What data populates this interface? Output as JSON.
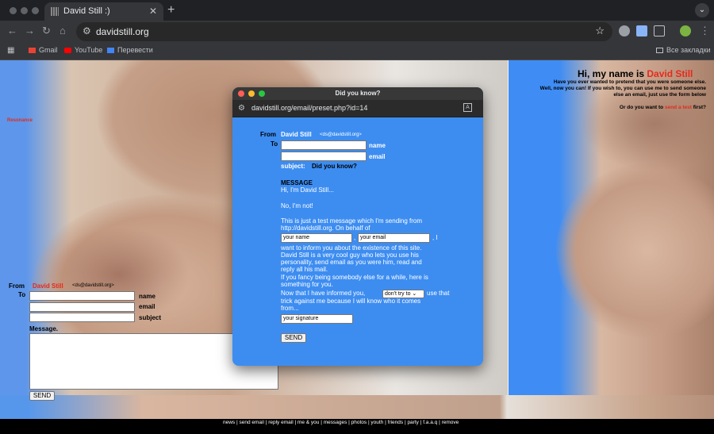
{
  "tab": {
    "title": "David Still :)",
    "close": "✕",
    "new_tab": "+",
    "menu": "⌄"
  },
  "toolbar": {
    "back": "←",
    "forward": "→",
    "reload": "↻",
    "home": "⌂",
    "url": "davidstill.org",
    "star": "☆",
    "more": "⋮"
  },
  "bookmarks": {
    "items": [
      {
        "label": "Gmail",
        "color": "#ea4335"
      },
      {
        "label": "YouTube",
        "color": "#ff0000"
      },
      {
        "label": "Перевести",
        "color": "#4285f4"
      }
    ],
    "all": "Все закладки"
  },
  "page": {
    "resonance": "Resonance",
    "headline_prefix": "Hi, my name is ",
    "headline_name": "David Still",
    "intro_lines": [
      "Have you ever wanted to pretend that you were someone else.",
      "Well, now you can! If you wish to, you can use me to send someone",
      "else an email, just use the form below"
    ],
    "intro_or": "Or ",
    "intro_want": "do you want to ",
    "intro_link": "send a test",
    "intro_end": " first?",
    "form": {
      "from_label": "From",
      "from_name": "David Still",
      "from_email": "<ds@davidstill.org>",
      "to_label": "To",
      "name_label": "name",
      "email_label": "email",
      "subject_label": "subject",
      "message_label": "Message.",
      "send": "SEND"
    }
  },
  "footer": {
    "links": "news | send email | reply email | me & you | messages | photos | youth | friends | party | f.a.a.q | remove"
  },
  "popup": {
    "title": "Did you know?",
    "url": "davidstill.org/email/preset.php?id=14",
    "from_label": "From",
    "from_name": "David Still",
    "from_email": "<ds@davidstill.org>",
    "to_label": "To",
    "name_label": "name",
    "email_label": "email",
    "subject_label": "subject:",
    "subject_value": "Did you know?",
    "message_label": "MESSAGE",
    "greeting": "Hi, I'm David Still...",
    "no": "No, I'm not!",
    "para1_a": "This is just a test message which I'm sending from",
    "para1_b": "http://davidstill.org. On behalf of",
    "name_placeholder": "your name",
    "comma": ",",
    "email_placeholder": "your email",
    "comma_i": ", I",
    "para2": [
      "want to inform you about the existence of this site.",
      "David Still is a very cool guy who lets you use his",
      "personality, send email as you were him, read and",
      "reply all his mail.",
      "If you fancy being somebody else for a while, here is",
      "something for you."
    ],
    "informed": "Now that I have informed you,",
    "select_value": "don't try to",
    "use_that": "use that",
    "trick": "trick against me because I will know who it comes",
    "from": "from...",
    "signature_placeholder": "your signature",
    "send": "SEND"
  }
}
